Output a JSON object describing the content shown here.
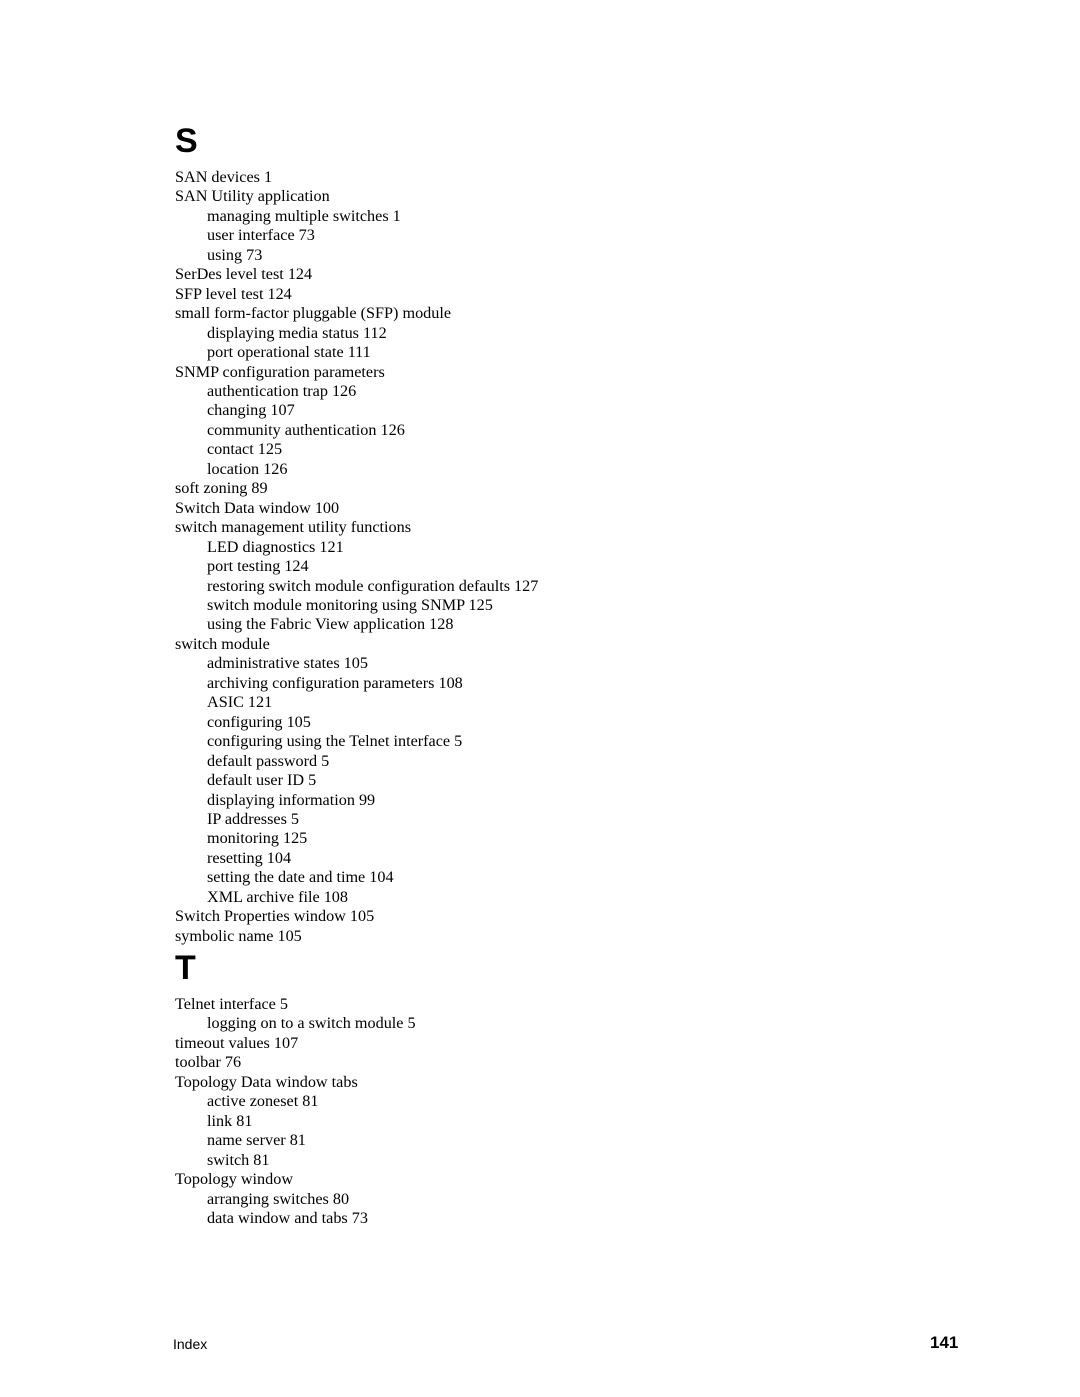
{
  "sections": [
    {
      "letter": "S",
      "entries": [
        {
          "text": "SAN devices 1",
          "level": 0
        },
        {
          "text": "SAN Utility application",
          "level": 0
        },
        {
          "text": "managing multiple switches 1",
          "level": 1
        },
        {
          "text": "user interface 73",
          "level": 1
        },
        {
          "text": "using 73",
          "level": 1
        },
        {
          "text": "SerDes level test 124",
          "level": 0
        },
        {
          "text": "SFP level test 124",
          "level": 0
        },
        {
          "text": "small form-factor pluggable (SFP) module",
          "level": 0
        },
        {
          "text": "displaying media status 112",
          "level": 1
        },
        {
          "text": "port operational state 111",
          "level": 1
        },
        {
          "text": "SNMP configuration parameters",
          "level": 0
        },
        {
          "text": "authentication trap 126",
          "level": 1
        },
        {
          "text": "changing 107",
          "level": 1
        },
        {
          "text": "community authentication 126",
          "level": 1
        },
        {
          "text": "contact 125",
          "level": 1
        },
        {
          "text": "location 126",
          "level": 1
        },
        {
          "text": "soft zoning 89",
          "level": 0
        },
        {
          "text": "Switch Data window 100",
          "level": 0
        },
        {
          "text": "switch management utility functions",
          "level": 0
        },
        {
          "text": "LED diagnostics 121",
          "level": 1
        },
        {
          "text": "port testing 124",
          "level": 1
        },
        {
          "text": "restoring switch module configuration defaults 127",
          "level": 1
        },
        {
          "text": "switch module monitoring using SNMP 125",
          "level": 1
        },
        {
          "text": "using the Fabric View application 128",
          "level": 1
        },
        {
          "text": "switch module",
          "level": 0
        },
        {
          "text": "administrative states 105",
          "level": 1
        },
        {
          "text": "archiving configuration parameters 108",
          "level": 1
        },
        {
          "text": "ASIC 121",
          "level": 1
        },
        {
          "text": "configuring 105",
          "level": 1
        },
        {
          "text": "configuring using the Telnet interface 5",
          "level": 1
        },
        {
          "text": "default password 5",
          "level": 1
        },
        {
          "text": "default user ID 5",
          "level": 1
        },
        {
          "text": "displaying information 99",
          "level": 1
        },
        {
          "text": "IP addresses 5",
          "level": 1
        },
        {
          "text": "monitoring 125",
          "level": 1
        },
        {
          "text": "resetting 104",
          "level": 1
        },
        {
          "text": "setting the date and time 104",
          "level": 1
        },
        {
          "text": "XML archive file 108",
          "level": 1
        },
        {
          "text": "Switch Properties window 105",
          "level": 0
        },
        {
          "text": "symbolic name 105",
          "level": 0
        }
      ]
    },
    {
      "letter": "T",
      "entries": [
        {
          "text": "Telnet interface 5",
          "level": 0
        },
        {
          "text": "logging on to a switch module 5",
          "level": 1
        },
        {
          "text": "timeout values 107",
          "level": 0
        },
        {
          "text": "toolbar 76",
          "level": 0
        },
        {
          "text": "Topology Data window tabs",
          "level": 0
        },
        {
          "text": "active zoneset 81",
          "level": 1
        },
        {
          "text": "link 81",
          "level": 1
        },
        {
          "text": "name server 81",
          "level": 1
        },
        {
          "text": "switch 81",
          "level": 1
        },
        {
          "text": "Topology window",
          "level": 0
        },
        {
          "text": "arranging switches 80",
          "level": 1
        },
        {
          "text": "data window and tabs 73",
          "level": 1
        }
      ]
    }
  ],
  "footer": {
    "label": "Index",
    "page_number": "141"
  }
}
